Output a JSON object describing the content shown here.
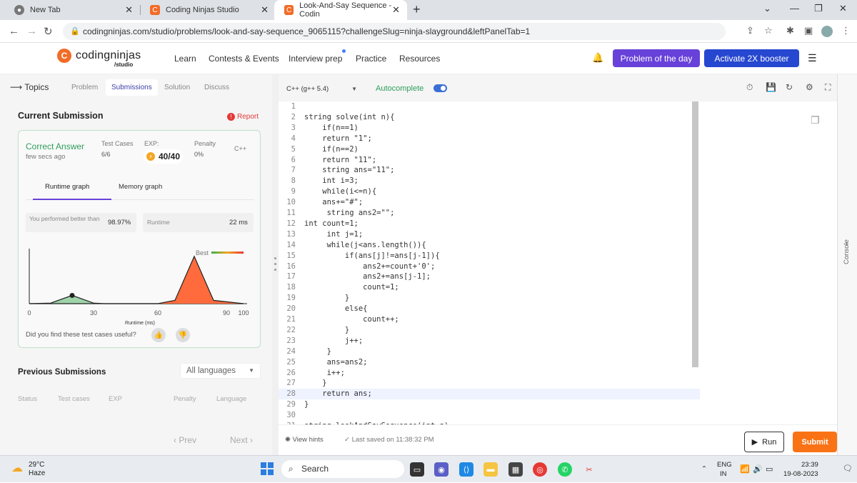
{
  "browser": {
    "tabs": [
      {
        "label": "New Tab"
      },
      {
        "label": "Coding Ninjas Studio"
      },
      {
        "label": "Look-And-Say Sequence - Codin"
      }
    ],
    "url": "codingninjas.com/studio/problems/look-and-say-sequence_9065115?challengeSlug=ninja-slayground&leftPanelTab=1"
  },
  "site": {
    "logo_name": "codingninjas",
    "logo_sub": "/studio",
    "nav": [
      "Learn",
      "Contests & Events",
      "Interview prep",
      "Practice",
      "Resources"
    ],
    "potd": "Problem of the day",
    "boost": "Activate 2X booster"
  },
  "left": {
    "topics": "Topics",
    "tabs": [
      "Problem",
      "Submissions",
      "Solution",
      "Discuss"
    ],
    "current_title": "Current Submission",
    "report": "Report",
    "status": "Correct Answer",
    "time": "few secs ago",
    "tc_label": "Test Cases",
    "tc_value": "6/6",
    "exp_label": "EXP:",
    "exp_value": "40/40",
    "penalty_label": "Penalty",
    "penalty_value": "0%",
    "language": "C++",
    "graph_tabs": [
      "Runtime graph",
      "Memory graph"
    ],
    "perf_label": "You performed better than",
    "perf_value": "98.97%",
    "runtime_label": "Runtime",
    "runtime_value": "22 ms",
    "useful": "Did you find these test cases useful?",
    "prev_title": "Previous Submissions",
    "lang_filter": "All languages",
    "cols": [
      "Status",
      "Test cases",
      "EXP",
      "Penalty",
      "Language"
    ],
    "prev": "Prev",
    "next": "Next"
  },
  "chart_data": {
    "type": "area",
    "xlabel": "Runtime (ms)",
    "x_ticks": [
      "0",
      "30",
      "60",
      "90",
      "100"
    ],
    "xlim": [
      0,
      100
    ],
    "legend": "Best",
    "series": [
      {
        "name": "Best",
        "color": "#ff6b3d",
        "x": [
          0,
          60,
          68,
          77,
          86,
          100
        ],
        "y": [
          0,
          0,
          0.06,
          0.86,
          0.06,
          0
        ]
      }
    ],
    "user_series": {
      "color": "#9fd3a8",
      "x": [
        0,
        10,
        20,
        30,
        35,
        100
      ],
      "y": [
        0,
        0.01,
        0.15,
        0.01,
        0,
        0
      ]
    },
    "user_marker": {
      "x": 20,
      "y": 0.15
    }
  },
  "editor": {
    "language": "C++ (g++ 5.4)",
    "autocomplete": "Autocomplete",
    "lines": [
      {
        "n": "1",
        "t": ""
      },
      {
        "n": "2",
        "t": "string solve(int n){"
      },
      {
        "n": "3",
        "t": "    if(n==1)"
      },
      {
        "n": "4",
        "t": "    return \"1\";"
      },
      {
        "n": "5",
        "t": "    if(n==2)"
      },
      {
        "n": "6",
        "t": "    return \"11\";"
      },
      {
        "n": "7",
        "t": "    string ans=\"11\";"
      },
      {
        "n": "8",
        "t": "    int i=3;"
      },
      {
        "n": "9",
        "t": "    while(i<=n){"
      },
      {
        "n": "10",
        "t": "    ans+=\"#\";"
      },
      {
        "n": "11",
        "t": "     string ans2=\"\";"
      },
      {
        "n": "12",
        "t": "int count=1;"
      },
      {
        "n": "13",
        "t": "     int j=1;"
      },
      {
        "n": "14",
        "t": "     while(j<ans.length()){"
      },
      {
        "n": "15",
        "t": "         if(ans[j]!=ans[j-1]){"
      },
      {
        "n": "16",
        "t": "             ans2+=count+'0';"
      },
      {
        "n": "17",
        "t": "             ans2+=ans[j-1];"
      },
      {
        "n": "18",
        "t": "             count=1;"
      },
      {
        "n": "19",
        "t": "         }"
      },
      {
        "n": "20",
        "t": "         else{"
      },
      {
        "n": "21",
        "t": "             count++;"
      },
      {
        "n": "22",
        "t": "         }"
      },
      {
        "n": "23",
        "t": "         j++;"
      },
      {
        "n": "24",
        "t": "     }"
      },
      {
        "n": "25",
        "t": "     ans=ans2;"
      },
      {
        "n": "26",
        "t": "     i++;"
      },
      {
        "n": "27",
        "t": "    }"
      },
      {
        "n": "28",
        "t": "    return ans;"
      },
      {
        "n": "29",
        "t": "}"
      },
      {
        "n": "30",
        "t": ""
      },
      {
        "n": "31",
        "t": "string lookAndSaySequence(int n)"
      }
    ],
    "hints": "View hints",
    "saved": "Last saved on 11:38:32 PM",
    "run": "Run",
    "submit": "Submit",
    "console": "Console"
  },
  "taskbar": {
    "temp": "29°C",
    "cond": "Haze",
    "search": "Search",
    "lang1": "ENG",
    "lang2": "IN",
    "time": "23:39",
    "date": "19-08-2023"
  }
}
